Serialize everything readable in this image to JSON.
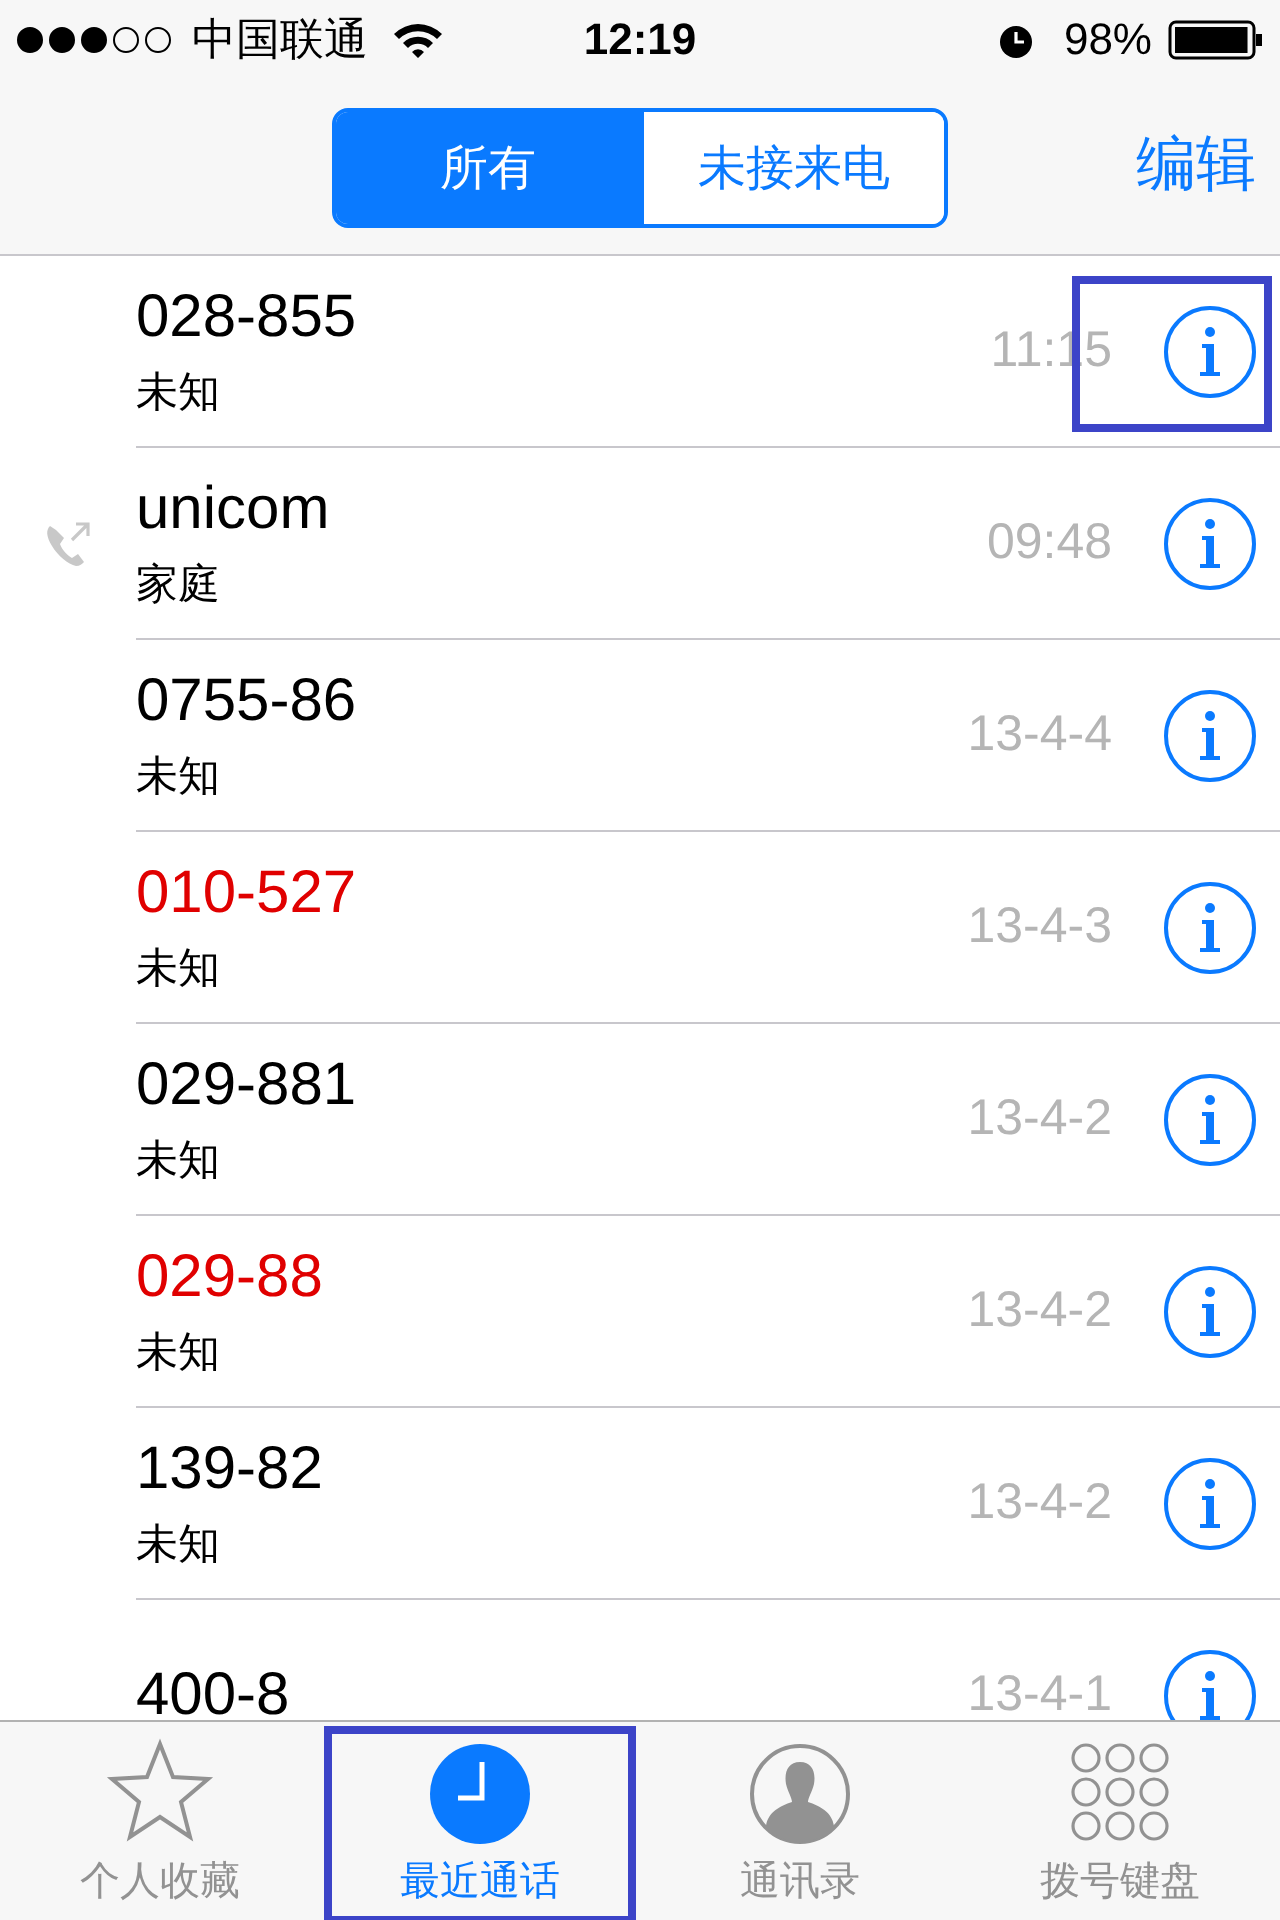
{
  "status_bar": {
    "carrier": "中国联通",
    "time": "12:19",
    "battery": "98%"
  },
  "segments": [
    {
      "label": "所有",
      "selected": true
    },
    {
      "label": "未接来电",
      "selected": false
    }
  ],
  "edit_button": "编辑",
  "calls": [
    {
      "number": "028-855",
      "label": "未知",
      "time": "11:15",
      "missed": false,
      "outgoing": false,
      "highlighted": true
    },
    {
      "number": "unicom",
      "label": "家庭",
      "time": "09:48",
      "missed": false,
      "outgoing": true,
      "highlighted": false
    },
    {
      "number": "0755-86",
      "label": "未知",
      "time": "13-4-4",
      "missed": false,
      "outgoing": false,
      "highlighted": false
    },
    {
      "number": "010-527",
      "label": "未知",
      "time": "13-4-3",
      "missed": true,
      "outgoing": false,
      "highlighted": false
    },
    {
      "number": "029-881",
      "label": "未知",
      "time": "13-4-2",
      "missed": false,
      "outgoing": false,
      "highlighted": false
    },
    {
      "number": "029-88",
      "label": "未知",
      "time": "13-4-2",
      "missed": true,
      "outgoing": false,
      "highlighted": false
    },
    {
      "number": "139-82",
      "label": "未知",
      "time": "13-4-2",
      "missed": false,
      "outgoing": false,
      "highlighted": false
    },
    {
      "number": "400-8",
      "time": "13-4-1",
      "missed": false,
      "outgoing": false,
      "highlighted": false
    }
  ],
  "tab_bar": [
    {
      "kind": "favorites",
      "label": "个人收藏",
      "selected": false,
      "highlighted": false
    },
    {
      "kind": "recents",
      "label": "最近通话",
      "selected": true,
      "highlighted": true
    },
    {
      "kind": "contacts",
      "label": "通讯录",
      "selected": false,
      "highlighted": false
    },
    {
      "kind": "keypad",
      "label": "拨号键盘",
      "selected": false,
      "highlighted": false
    }
  ]
}
